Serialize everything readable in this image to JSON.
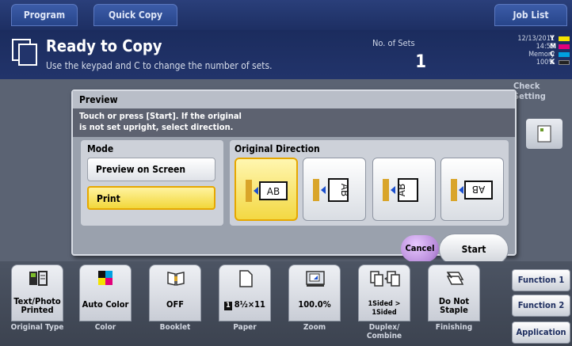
{
  "tabs": {
    "program": "Program",
    "quick_copy": "Quick Copy",
    "job_list": "Job List"
  },
  "status": {
    "title": "Ready to Copy",
    "subtitle": "Use the keypad and C to change the number of sets.",
    "sets_label": "No. of Sets",
    "sets_value": "1",
    "date": "12/13/2011",
    "time": "14:55",
    "memory_label": "Memory",
    "memory_value": "100%",
    "toner": [
      {
        "letter": "Y",
        "color": "#f2e200"
      },
      {
        "letter": "M",
        "color": "#e2007a"
      },
      {
        "letter": "C",
        "color": "#00a0e0"
      },
      {
        "letter": "K",
        "color": "#222222"
      }
    ],
    "check_setting": "Check Setting"
  },
  "dialog": {
    "title": "Preview",
    "message_line1": "Touch or press [Start]. If the original",
    "message_line2": "is not set upright, select direction.",
    "mode_label": "Mode",
    "mode_options": [
      "Preview on Screen",
      "Print"
    ],
    "mode_selected": "Print",
    "direction_label": "Original Direction",
    "direction_glyph": "AB",
    "direction_selected_index": 0,
    "cancel_label": "Cancel",
    "start_label": "Start"
  },
  "functions": [
    {
      "value": "Text/Photo\nPrinted",
      "label": "Original Type",
      "icon": "original-type-icon"
    },
    {
      "value": "Auto Color",
      "label": "Color",
      "icon": "color-icon"
    },
    {
      "value": "OFF",
      "label": "Booklet",
      "icon": "booklet-icon"
    },
    {
      "value": "8½×11",
      "label": "Paper",
      "icon": "paper-icon"
    },
    {
      "value": "100.0%",
      "label": "Zoom",
      "icon": "zoom-icon"
    },
    {
      "value": "1Sided > 1Sided",
      "label": "Duplex/\nCombine",
      "icon": "duplex-icon"
    },
    {
      "value": "Do Not\nStaple",
      "label": "Finishing",
      "icon": "finishing-icon"
    }
  ],
  "right_menu": {
    "function1": "Function 1",
    "function2": "Function 2",
    "application": "Application"
  }
}
